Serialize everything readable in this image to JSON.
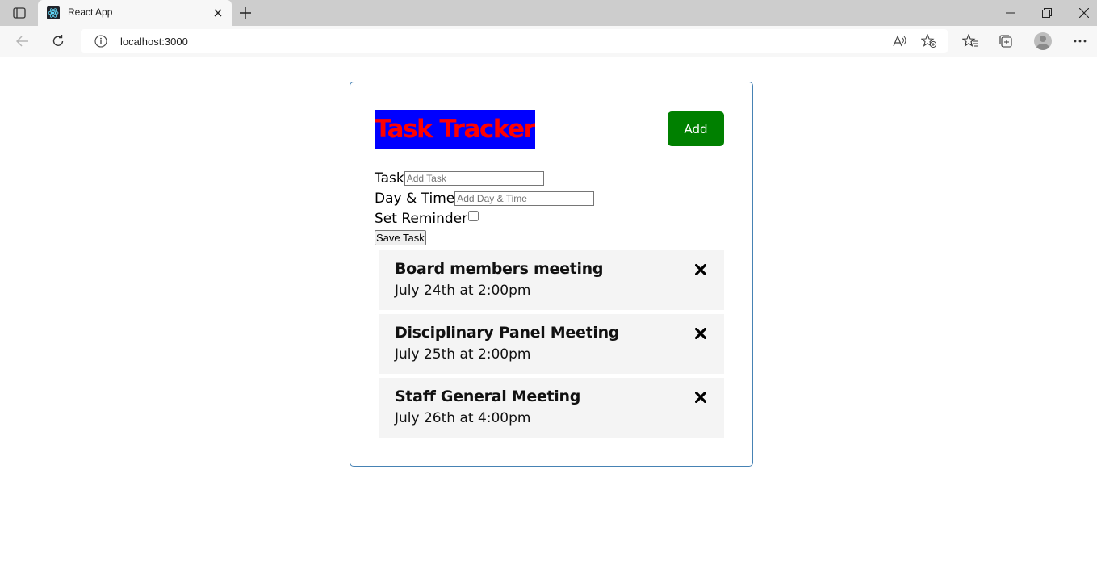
{
  "browser": {
    "tab_title": "React App",
    "url": "localhost:3000"
  },
  "app": {
    "title": "Task Tracker",
    "add_button_label": "Add",
    "title_bg_color": "#0000ff",
    "title_text_color": "#ff0000",
    "add_button_color": "#008000"
  },
  "form": {
    "task_label": "Task",
    "task_placeholder": "Add Task",
    "day_label": "Day & Time",
    "day_placeholder": "Add Day & Time",
    "reminder_label": "Set Reminder",
    "reminder_checked": false,
    "save_label": "Save Task"
  },
  "tasks": [
    {
      "text": "Board members meeting",
      "day": "July 24th at 2:00pm"
    },
    {
      "text": "Disciplinary Panel Meeting",
      "day": "July 25th at 2:00pm"
    },
    {
      "text": "Staff General Meeting",
      "day": "July 26th at 4:00pm"
    }
  ],
  "icons": {
    "tab_actions": "tab-actions-icon",
    "favicon": "react-logo-icon",
    "close_tab": "close-icon",
    "new_tab": "plus-icon",
    "minimize": "minimize-icon",
    "restore": "restore-icon",
    "close_window": "close-icon",
    "back": "back-arrow-icon",
    "refresh": "refresh-icon",
    "site_info": "info-icon",
    "read_aloud": "read-aloud-icon",
    "add_favorite": "star-add-icon",
    "favorites": "favorites-icon",
    "collections": "collections-icon",
    "profile": "avatar",
    "more": "more-icon",
    "delete_task": "times-icon"
  }
}
